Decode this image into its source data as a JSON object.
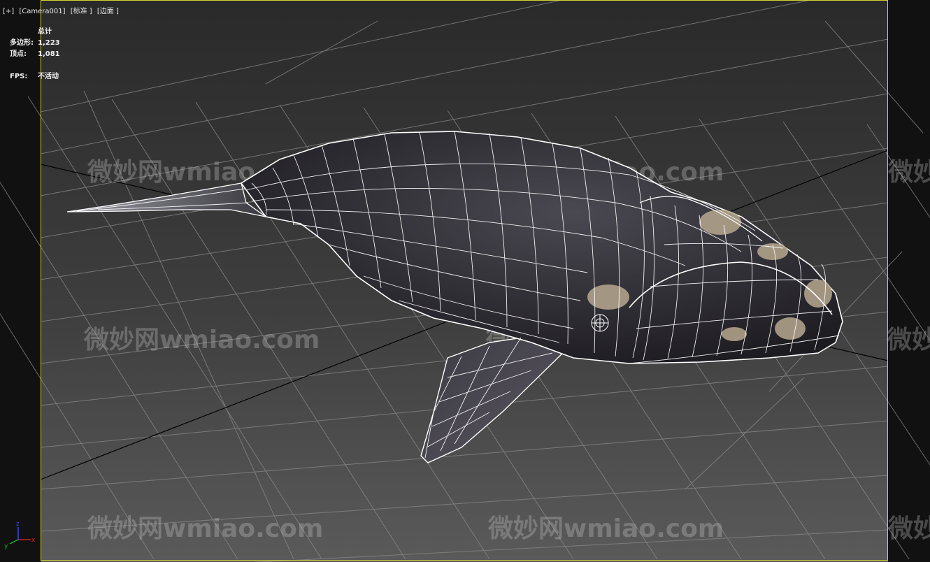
{
  "viewport": {
    "labels": [
      "[+]",
      "[Camera001]",
      "[标准 ]",
      "[边面 ]"
    ],
    "stats": {
      "header": "总计",
      "polygons_label": "多边形:",
      "polygons_value": "1,223",
      "vertices_label": "顶点:",
      "vertices_value": "1,081",
      "fps_label": "FPS:",
      "fps_value": "不活动"
    },
    "axis": {
      "x": "x",
      "y": "y",
      "z": "z"
    }
  },
  "watermark": "微妙网wmiao.com",
  "colors": {
    "frame": "#d6d230",
    "grid": "#8a8a8a",
    "wire": "#ffffff",
    "axis_x": "#d02020",
    "axis_y": "#20b020",
    "axis_z": "#3050e0"
  }
}
